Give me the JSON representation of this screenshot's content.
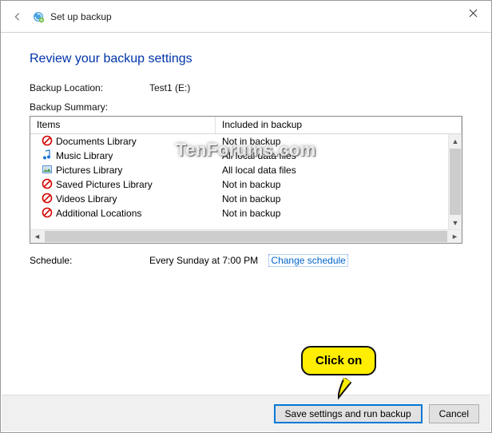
{
  "window": {
    "title": "Set up backup"
  },
  "heading": "Review your backup settings",
  "backup_location": {
    "label": "Backup Location:",
    "value": "Test1 (E:)"
  },
  "backup_summary_label": "Backup Summary:",
  "columns": {
    "items": "Items",
    "included": "Included in backup"
  },
  "rows": [
    {
      "icon": "prohibit",
      "name": "Documents Library",
      "status": "Not in backup"
    },
    {
      "icon": "music",
      "name": "Music Library",
      "status": "All local data files"
    },
    {
      "icon": "pictures",
      "name": "Pictures Library",
      "status": "All local data files"
    },
    {
      "icon": "prohibit",
      "name": "Saved Pictures Library",
      "status": "Not in backup"
    },
    {
      "icon": "prohibit",
      "name": "Videos Library",
      "status": "Not in backup"
    },
    {
      "icon": "prohibit",
      "name": "Additional Locations",
      "status": "Not in backup"
    }
  ],
  "schedule": {
    "label": "Schedule:",
    "value": "Every Sunday at 7:00 PM",
    "link": "Change schedule"
  },
  "buttons": {
    "primary": "Save settings and run backup",
    "cancel": "Cancel"
  },
  "callout": "Click on",
  "watermark": "TenForums.com"
}
